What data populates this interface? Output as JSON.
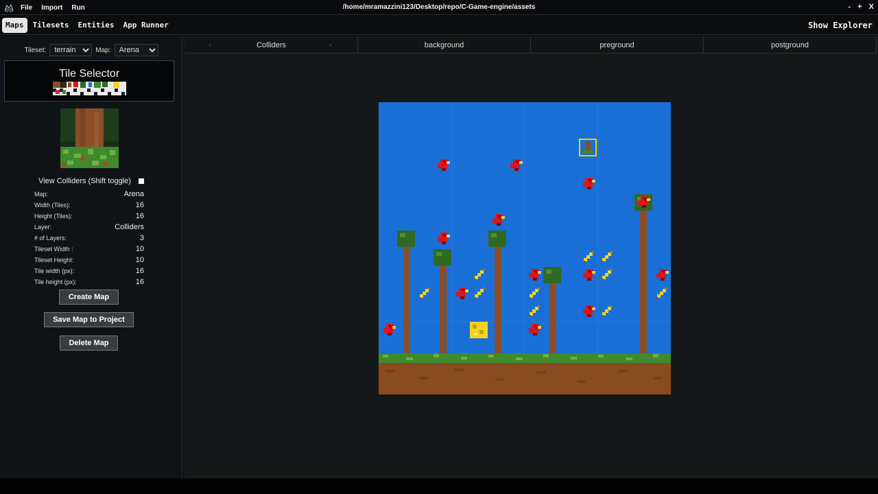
{
  "titlebar": {
    "menu": [
      "File",
      "Import",
      "Run"
    ],
    "path": "/home/mramazzini123/Desktop/repo/C-Game-engine/assets",
    "controls": [
      "-",
      "+",
      "X"
    ]
  },
  "nav": {
    "tabs": [
      "Maps",
      "Tilesets",
      "Entities",
      "App Runner"
    ],
    "active_tab": "Maps",
    "explorer": "Show Explorer"
  },
  "sidebar": {
    "tileset_label": "Tileset:",
    "tileset_value": "terrain",
    "map_label": "Map:",
    "map_value": "Arena",
    "tile_selector_title": "Tile Selector",
    "colliders_toggle": "View Colliders (Shift toggle)",
    "properties": [
      {
        "key": "Map:",
        "value": "Arena"
      },
      {
        "key": "Width (Tiles):",
        "value": "16"
      },
      {
        "key": "Height (Tiles):",
        "value": "16"
      },
      {
        "key": "Layer:",
        "value": "Colliders"
      },
      {
        "key": "# of Layers:",
        "value": "3"
      },
      {
        "key": "Tileset Width :",
        "value": "10"
      },
      {
        "key": "Tileset Height:",
        "value": "10"
      },
      {
        "key": "Tile width (px):",
        "value": "16"
      },
      {
        "key": "Tile height (px):",
        "value": "16"
      }
    ],
    "buttons": {
      "create": "Create Map",
      "save": "Save Map to Project",
      "delete": "Delete Map"
    }
  },
  "editor": {
    "layers": [
      "Colliders",
      "background",
      "preground",
      "postground"
    ],
    "active_layer": "Colliders"
  },
  "colors": {
    "sky": "#1a6fd6",
    "grass": "#3f8a2c",
    "dirt": "#8a4a1f",
    "trunk": "#8a4e2a",
    "leaves": "#2f6a24",
    "bird": "#e0141c",
    "banana": "#f3d422",
    "selection": "#f2d000"
  }
}
